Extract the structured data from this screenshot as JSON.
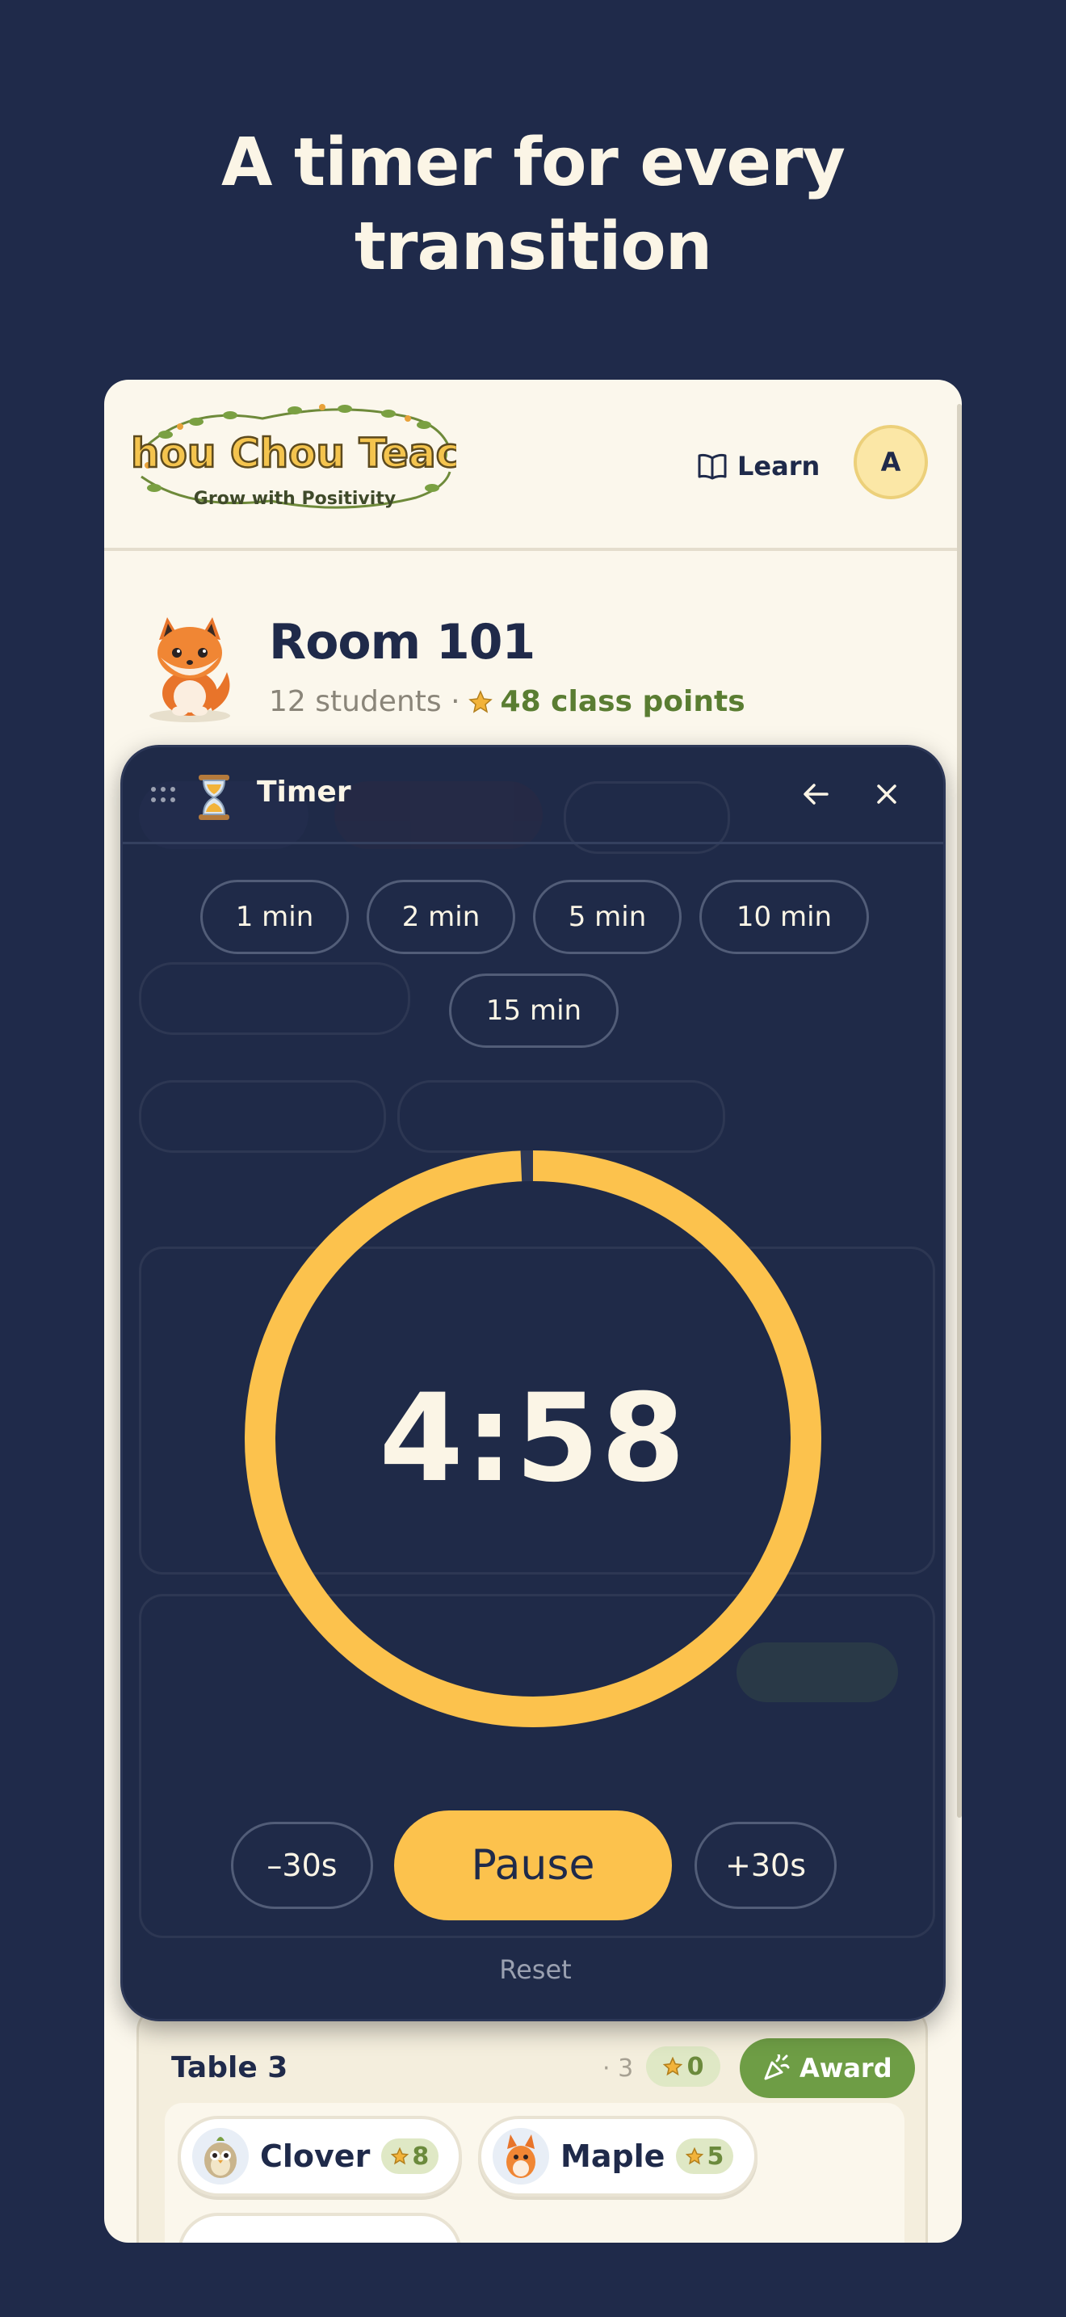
{
  "headline": {
    "line1": "A timer for every",
    "line2": "transition"
  },
  "app": {
    "logo_title": "Chou Chou Teach",
    "logo_tagline": "Grow with Positivity",
    "learn_label": "Learn",
    "avatar_initial": "A"
  },
  "room": {
    "title": "Room 101",
    "students": "12 students ·",
    "points": "48 class points"
  },
  "timer": {
    "title": "Timer",
    "presets": [
      "1 min",
      "2 min",
      "5 min",
      "10 min",
      "15 min"
    ],
    "time": "4:58",
    "minus_label": "–30s",
    "pause_label": "Pause",
    "plus_label": "+30s",
    "reset_label": "Reset",
    "progress_fraction": 0.993
  },
  "table3": {
    "name": "Table 3",
    "count": "· 3",
    "stars": "0",
    "award_label": "Award",
    "students": [
      {
        "name": "Clover",
        "points": "8"
      },
      {
        "name": "Maple",
        "points": "5"
      }
    ]
  },
  "colors": {
    "background": "#1f2a4a",
    "accent": "#fcc24d",
    "award_green": "#6e9d45"
  }
}
